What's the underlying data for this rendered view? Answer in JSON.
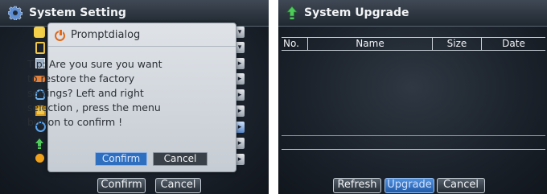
{
  "system_setting": {
    "title": "System Setting",
    "menu_icons": [
      "ptz-icon",
      "storage-icon",
      "record-icon",
      "vehicle-icon",
      "user-icon",
      "save-icon",
      "network-icon",
      "upgrade-icon",
      "info-icon"
    ],
    "bottom_buttons": {
      "confirm": "Confirm",
      "cancel": "Cancel"
    }
  },
  "prompt_dialog": {
    "title": "Promptdialog",
    "message_lines": [
      "Tip: Are you sure you want",
      "to restore the factory",
      "settings? Left and right",
      "selection , press the menu",
      "button to confirm !"
    ],
    "confirm_label": "Confirm",
    "cancel_label": "Cancel",
    "selected_button": "confirm"
  },
  "system_upgrade": {
    "title": "System Upgrade",
    "columns": [
      "No.",
      "Name",
      "Size",
      "Date"
    ],
    "rows": [],
    "buttons": {
      "refresh": "Refresh",
      "upgrade": "Upgrade",
      "cancel": "Cancel"
    },
    "selected_button": "upgrade"
  },
  "colors": {
    "accent_selected": "#2f6fbf",
    "dialog_bg": "#d3d8de",
    "screen_bg": "#1c232c"
  }
}
